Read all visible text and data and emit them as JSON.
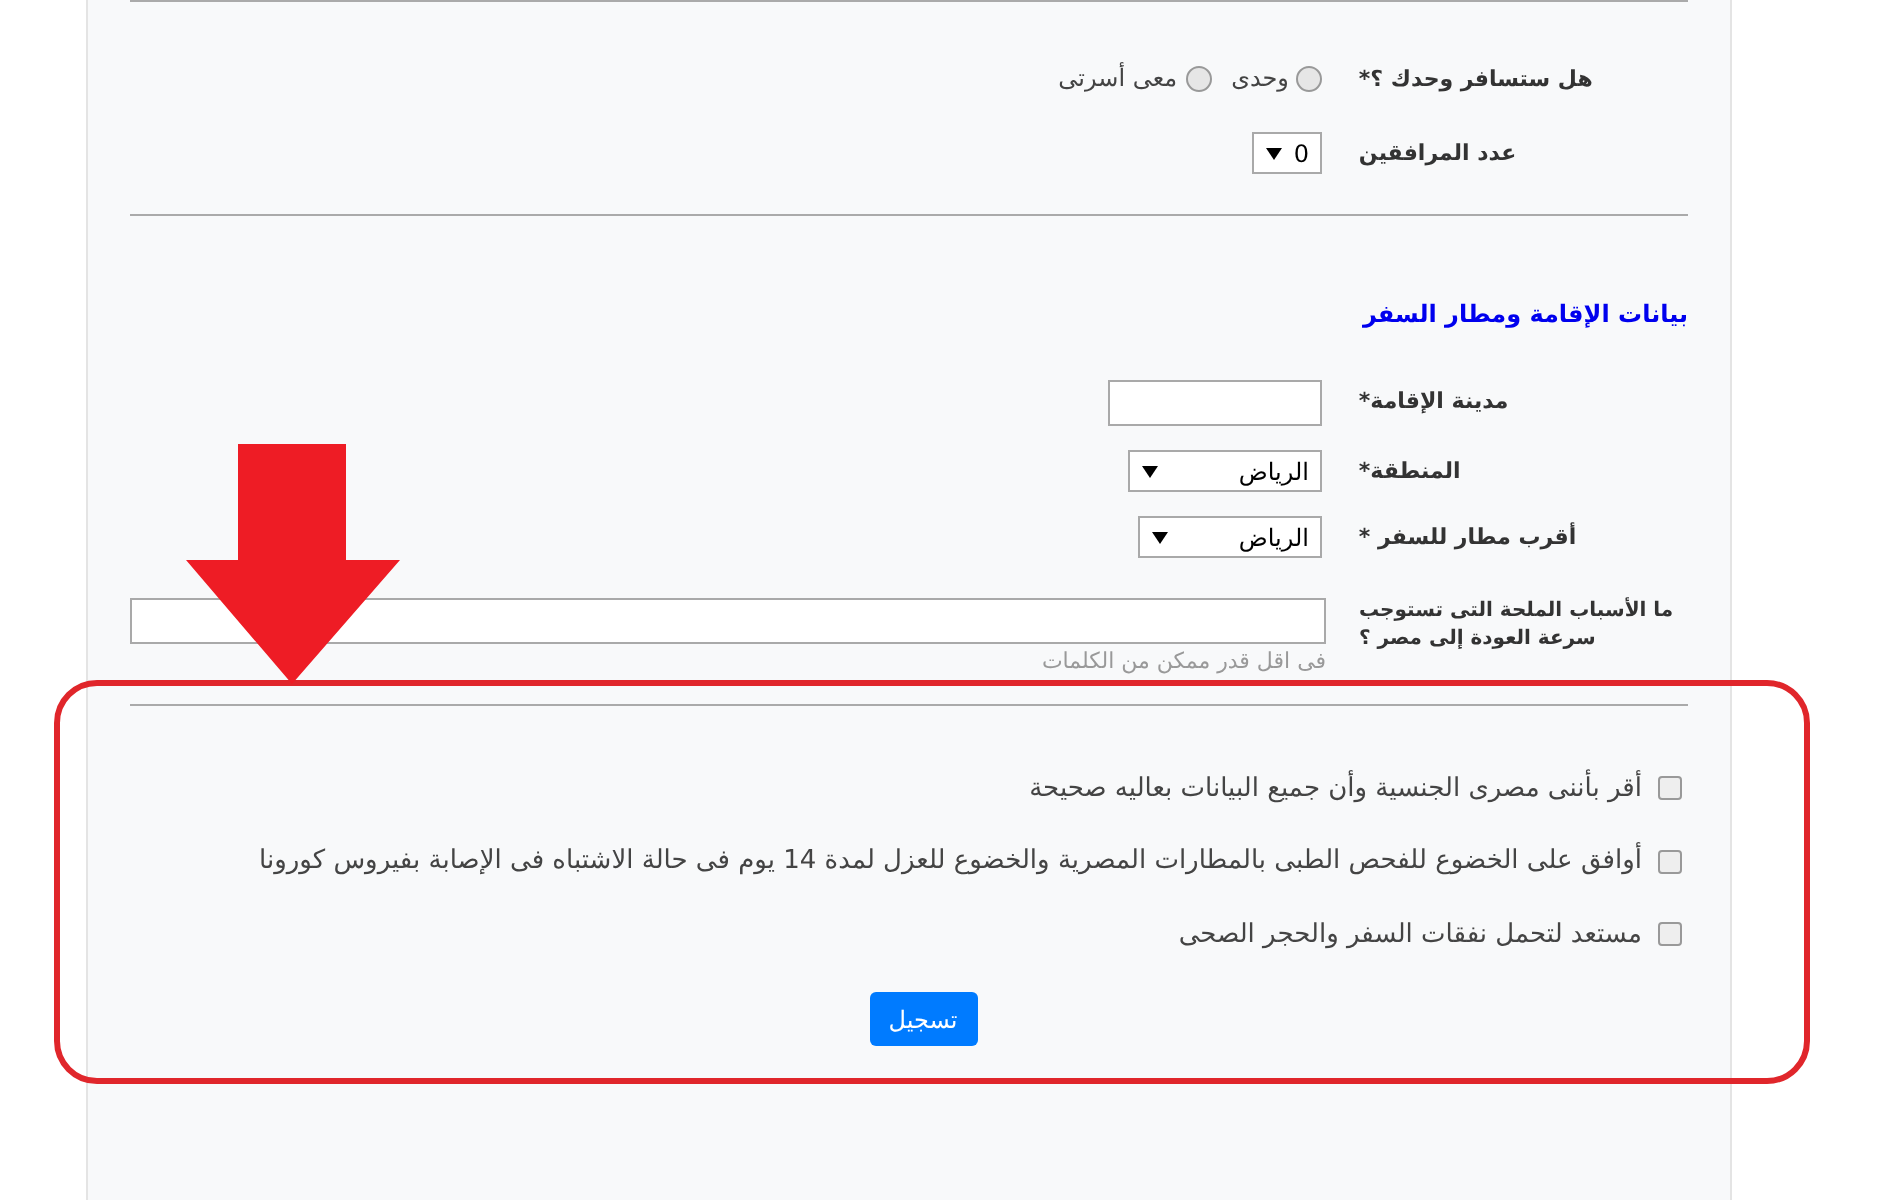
{
  "travel": {
    "question": {
      "label": "هل ستسافر وحدك ؟*",
      "options": [
        {
          "label": "وحدى",
          "selected": false
        },
        {
          "label": "معى أسرتى",
          "selected": false
        }
      ]
    },
    "companions": {
      "label": "عدد المرافقين",
      "value": "0"
    }
  },
  "residence": {
    "title": "بيانات الإقامة ومطار السفر",
    "fields": [
      {
        "kind": "text",
        "label": "مدينة الإقامة*"
      },
      {
        "kind": "select",
        "label": "المنطقة*",
        "value": "الرياض"
      },
      {
        "kind": "select",
        "label": "أقرب مطار للسفر *",
        "value": "الرياض"
      },
      {
        "kind": "textarea",
        "label": "ما الأسباب الملحة التى تستوجب سرعة العودة إلى مصر ؟",
        "hint": "فى اقل قدر ممكن من الكلمات"
      }
    ]
  },
  "agreements": [
    {
      "label": "أقر بأننى مصرى الجنسية وأن جميع البيانات بعاليه صحيحة",
      "checked": false
    },
    {
      "label": "أوافق على الخضوع للفحص الطبى بالمطارات المصرية والخضوع للعزل لمدة 14 يوم فى حالة الاشتباه فى الإصابة بفيروس كورونا",
      "checked": false
    },
    {
      "label": "مستعد لتحمل نفقات السفر والحجر الصحى",
      "checked": false
    }
  ],
  "submit": "تسجيل"
}
